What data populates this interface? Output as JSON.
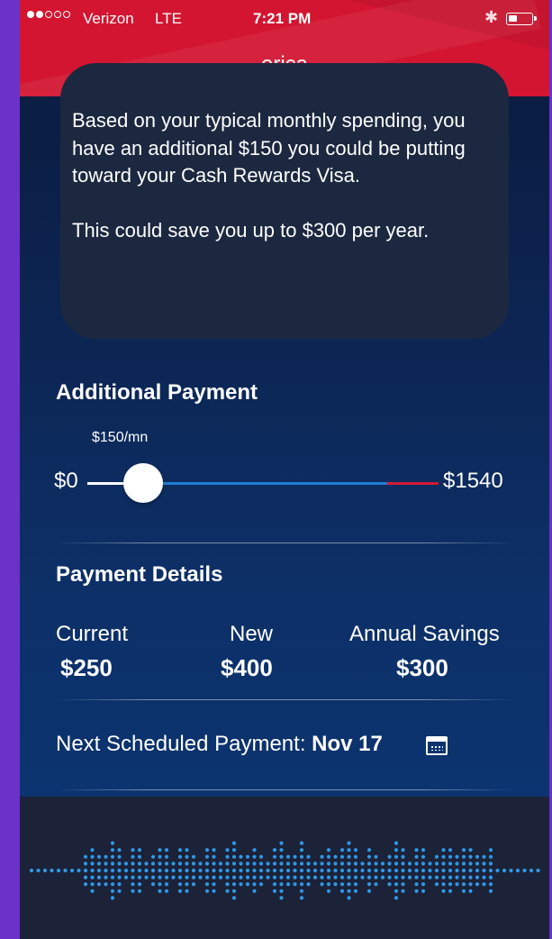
{
  "status_bar": {
    "signal_dots": [
      true,
      true,
      false,
      false,
      false
    ],
    "carrier": "Verizon",
    "network": "LTE",
    "time": "7:21 PM"
  },
  "header": {
    "title": "erica"
  },
  "message": {
    "paragraphs": [
      "Based on your typical monthly spending, you have an additional $150 you could be putting toward your Cash Rewards Visa.",
      "This could save you up to $300 per year."
    ]
  },
  "additional_payment": {
    "title": "Additional Payment",
    "slider_value_label": "$150/mn",
    "min_label": "$0",
    "max_label": "$1540",
    "value_fraction": 0.097
  },
  "payment_details": {
    "title": "Payment Details",
    "columns": [
      {
        "label": "Current",
        "value": "$250"
      },
      {
        "label": "New",
        "value": "$400"
      },
      {
        "label": "Annual Savings",
        "value": "$300"
      }
    ],
    "next_payment_label": "Next Scheduled Payment:",
    "next_payment_date": "Nov 17"
  },
  "colors": {
    "header_red": "#d31531",
    "slider_blue": "#1f7dd4",
    "slider_red": "#d11a35",
    "voice_wave": "#2f98e6"
  }
}
